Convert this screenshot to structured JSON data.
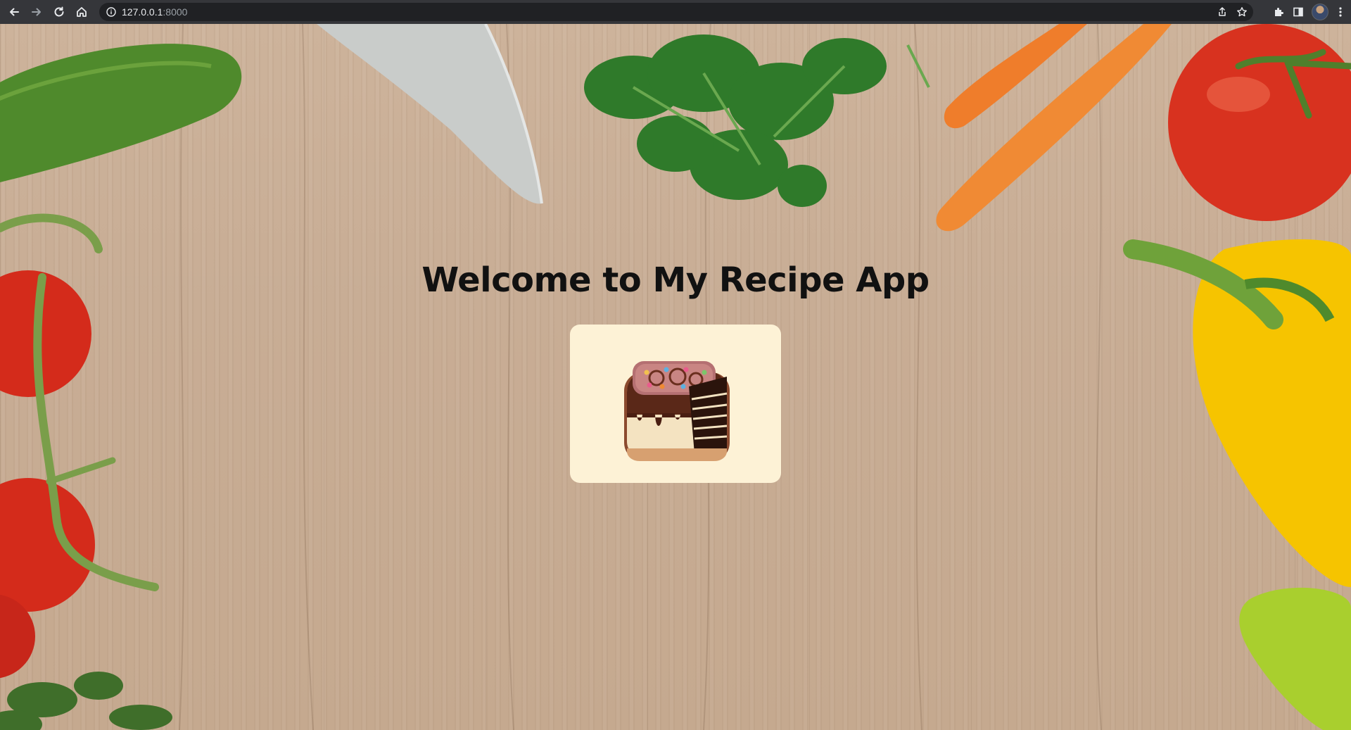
{
  "browser": {
    "url_host": "127.0.0.1",
    "url_port": ":8000",
    "toolbar_icons": {
      "back": "arrow-left-icon",
      "forward": "arrow-right-icon",
      "reload": "reload-icon",
      "home": "home-icon",
      "site_info": "info-icon",
      "share": "share-icon",
      "bookmark": "star-icon",
      "extensions": "puzzle-icon",
      "side_panel": "side-panel-icon",
      "profile": "avatar",
      "menu": "kebab-menu-icon"
    }
  },
  "page": {
    "title": "Welcome to My Recipe App",
    "logo": "cake-logo",
    "background": "wooden-board-with-vegetables",
    "colors": {
      "title": "#111111",
      "logo_card": "#fdf2d6"
    }
  }
}
